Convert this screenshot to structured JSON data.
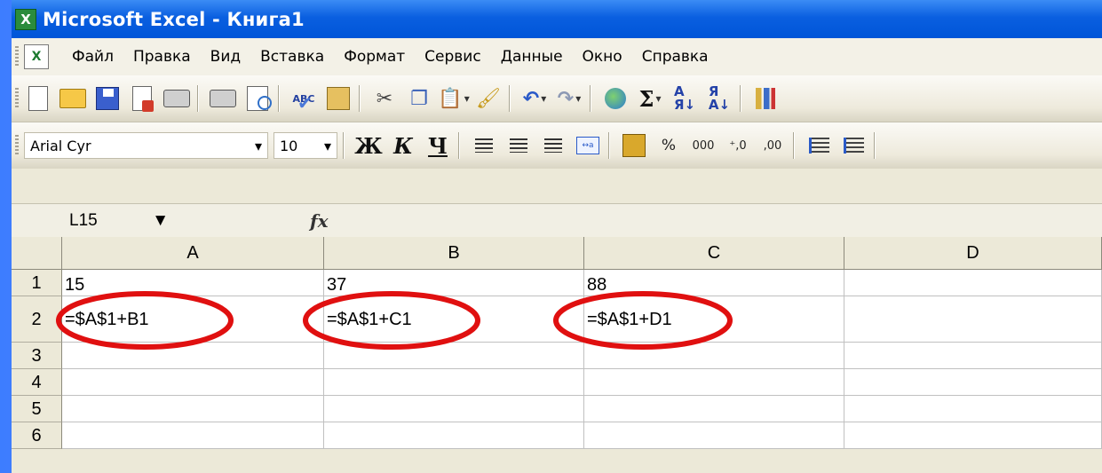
{
  "window": {
    "title": "Microsoft Excel - Книга1",
    "app_icon_glyph": "X"
  },
  "menu": [
    {
      "label": "Файл"
    },
    {
      "label": "Правка"
    },
    {
      "label": "Вид"
    },
    {
      "label": "Вставка"
    },
    {
      "label": "Формат"
    },
    {
      "label": "Сервис"
    },
    {
      "label": "Данные"
    },
    {
      "label": "Окно"
    },
    {
      "label": "Справка"
    }
  ],
  "format_toolbar": {
    "font_name": "Arial Cyr",
    "font_size": "10",
    "bold_label": "Ж",
    "italic_label": "К",
    "underline_label": "Ч",
    "percent_label": "%",
    "thousands_label": "000",
    "inc_decimal_label": "←,0 ,00",
    "dec_decimal_label": ",00 →,0"
  },
  "formula_bar": {
    "name_box": "L15",
    "fx_label": "fx",
    "formula": ""
  },
  "sheet": {
    "columns": [
      "A",
      "B",
      "C",
      "D"
    ],
    "rows": [
      {
        "num": "1",
        "cells": [
          "15",
          "37",
          "88",
          ""
        ]
      },
      {
        "num": "2",
        "cells": [
          "=$A$1+B1",
          "=$A$1+C1",
          "=$A$1+D1",
          ""
        ]
      },
      {
        "num": "3",
        "cells": [
          "",
          "",
          "",
          ""
        ]
      },
      {
        "num": "4",
        "cells": [
          "",
          "",
          "",
          ""
        ]
      },
      {
        "num": "5",
        "cells": [
          "",
          "",
          "",
          ""
        ]
      },
      {
        "num": "6",
        "cells": [
          "",
          "",
          "",
          ""
        ]
      }
    ]
  },
  "annotation": {
    "highlight_color": "#e01010"
  },
  "icons": {
    "standard": [
      "new-icon",
      "open-icon",
      "save-icon",
      "permission-icon",
      "print-icon",
      "print-preview-icon",
      "spelling-icon",
      "research-icon",
      "cut-icon",
      "copy-icon",
      "paste-icon",
      "format-painter-icon",
      "undo-icon",
      "redo-icon",
      "hyperlink-icon",
      "autosum-icon",
      "sort-ascending-icon",
      "sort-descending-icon",
      "chart-wizard-icon"
    ]
  }
}
